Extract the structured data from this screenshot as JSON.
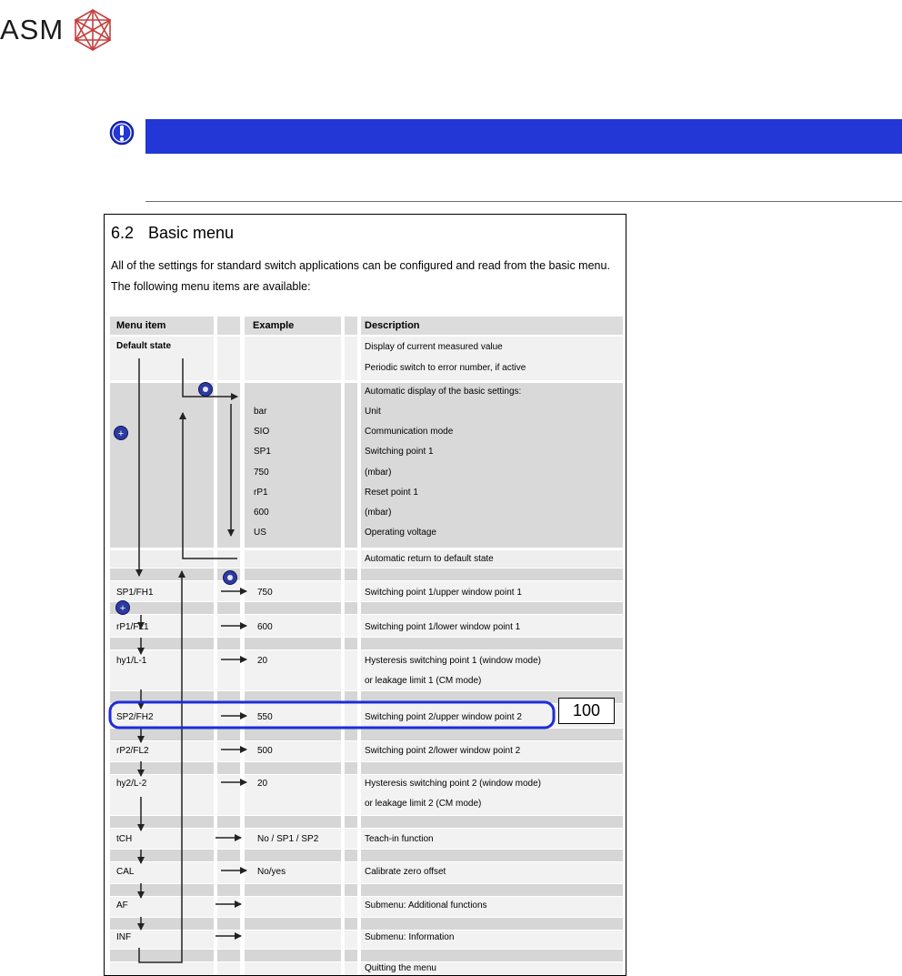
{
  "header": {
    "logo_text": "ASM",
    "logo_icon": "asm-geometric-logo"
  },
  "notice": {
    "icon": "exclamation-circle-icon",
    "bar_color": "#2336d6"
  },
  "doc": {
    "section_number": "6.2",
    "section_title": "Basic menu",
    "intro_line1": "All of the settings for standard switch applications can be configured and read from the basic menu.",
    "intro_line2": "The following menu items are available:",
    "columns": {
      "menu_item": "Menu item",
      "example": "Example",
      "description": "Description"
    },
    "rows": {
      "default_state": {
        "item": "Default state",
        "desc1": "Display of current measured value",
        "desc2": "Periodic switch to error number, if active"
      },
      "auto_display": {
        "desc": "Automatic display of the basic settings:"
      },
      "bar": {
        "example": "bar",
        "desc": "Unit"
      },
      "sio": {
        "example": "SIO",
        "desc": "Communication mode"
      },
      "sp1": {
        "example": "SP1",
        "desc": "Switching point 1"
      },
      "v750": {
        "example": "750",
        "desc": "(mbar)"
      },
      "rp1": {
        "example": "rP1",
        "desc": "Reset point 1"
      },
      "v600": {
        "example": "600",
        "desc": "(mbar)"
      },
      "us": {
        "example": "US",
        "desc": "Operating voltage"
      },
      "auto_return": {
        "desc": "Automatic return to default state"
      },
      "sp1fh1": {
        "item": "SP1/FH1",
        "example": "750",
        "desc": "Switching point 1/upper window point 1"
      },
      "rp1fl1": {
        "item": "rP1/FL1",
        "example": "600",
        "desc": "Switching point 1/lower window point 1"
      },
      "hy1": {
        "item": "hy1/L-1",
        "example": "20",
        "desc1": "Hysteresis switching point 1 (window mode)",
        "desc2": "or leakage limit 1 (CM mode)"
      },
      "sp2fh2": {
        "item": "SP2/FH2",
        "example": "550",
        "desc": "Switching point 2/upper window point 2"
      },
      "rp2fl2": {
        "item": "rP2/FL2",
        "example": "500",
        "desc": "Switching point 2/lower window point 2"
      },
      "hy2": {
        "item": "hy2/L-2",
        "example": "20",
        "desc1": "Hysteresis switching point 2 (window mode)",
        "desc2": "or leakage limit 2 (CM mode)"
      },
      "tch": {
        "item": "tCH",
        "example": "No / SP1 / SP2",
        "desc": "Teach-in function"
      },
      "cal": {
        "item": "CAL",
        "example": "No/yes",
        "desc": "Calibrate zero offset"
      },
      "af": {
        "item": "AF",
        "desc": "Submenu: Additional functions"
      },
      "inf": {
        "item": "INF",
        "desc": "Submenu: Information"
      },
      "quit": {
        "desc": "Quitting the menu"
      }
    },
    "callout_value": "100",
    "highlight_color": "#1e2bd8"
  }
}
